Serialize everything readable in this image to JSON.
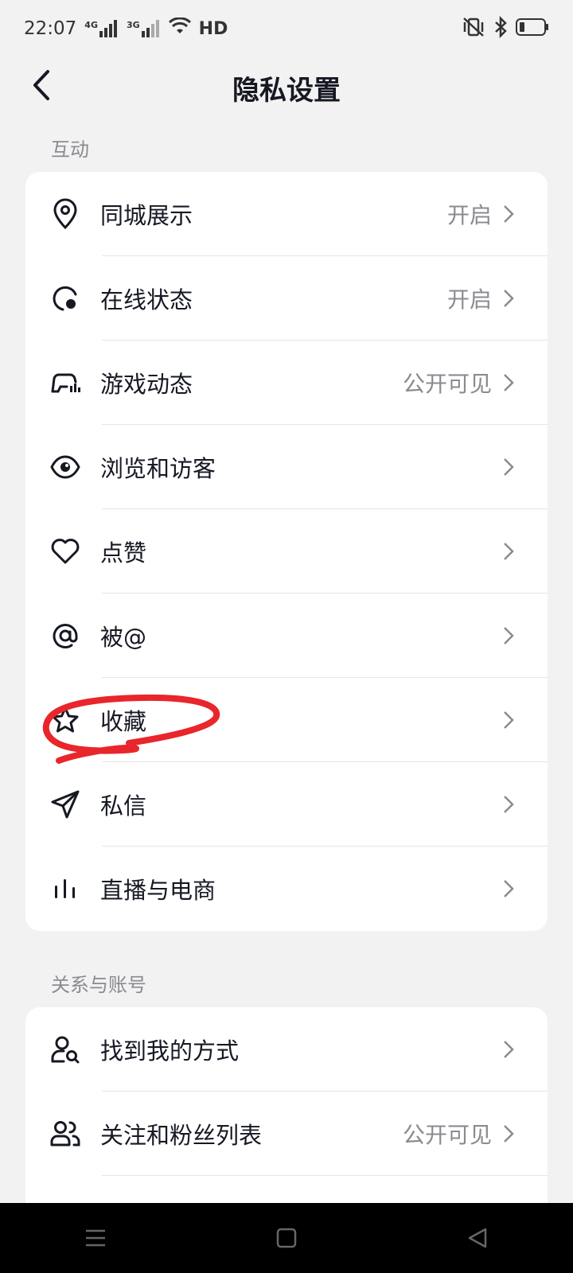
{
  "status_bar": {
    "time": "22:07",
    "network1": "4G",
    "network2": "3G",
    "hd": "HD"
  },
  "header": {
    "title": "隐私设置",
    "back_icon": "back-arrow-icon"
  },
  "sections": [
    {
      "label": "互动",
      "items": [
        {
          "icon": "location-pin-icon",
          "label": "同城展示",
          "value": "开启"
        },
        {
          "icon": "online-status-icon",
          "label": "在线状态",
          "value": "开启"
        },
        {
          "icon": "gamepad-icon",
          "label": "游戏动态",
          "value": "公开可见"
        },
        {
          "icon": "eye-icon",
          "label": "浏览和访客",
          "value": ""
        },
        {
          "icon": "heart-icon",
          "label": "点赞",
          "value": ""
        },
        {
          "icon": "at-icon",
          "label": "被@",
          "value": ""
        },
        {
          "icon": "star-icon",
          "label": "收藏",
          "value": ""
        },
        {
          "icon": "paper-plane-icon",
          "label": "私信",
          "value": ""
        },
        {
          "icon": "live-bars-icon",
          "label": "直播与电商",
          "value": ""
        }
      ]
    },
    {
      "label": "关系与账号",
      "items": [
        {
          "icon": "user-search-icon",
          "label": "找到我的方式",
          "value": ""
        },
        {
          "icon": "users-icon",
          "label": "关注和粉丝列表",
          "value": "公开可见"
        }
      ]
    }
  ],
  "colors": {
    "background": "#f2f2f2",
    "card": "#ffffff",
    "text_primary": "#161823",
    "text_secondary": "#8a8b91",
    "annotation": "#e8262b"
  }
}
